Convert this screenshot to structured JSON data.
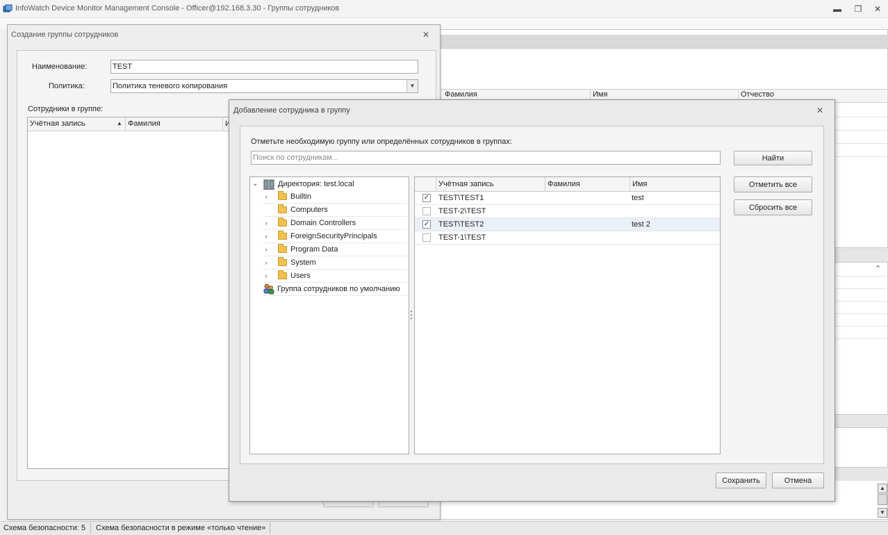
{
  "app": {
    "title": "InfoWatch Device Monitor Management Console - Officer@192.168.3.30 - Группы сотрудников",
    "minimize": "▬",
    "restore": "❐",
    "close": "✕"
  },
  "background": {
    "columns": [
      "Фамилия",
      "Имя",
      "Отчество"
    ],
    "scroll_up": "▲",
    "scroll_down": "▼",
    "collapse": "⌃"
  },
  "status_bar": {
    "schema": "Схема безопасности: 5",
    "mode": "Схема безопасности в режиме «только чтение»"
  },
  "create_dialog": {
    "title": "Создание группы сотрудников",
    "close": "✕",
    "name_label": "Наименование:",
    "name_value": "TEST",
    "policy_label": "Политика:",
    "policy_value": "Политика теневого копирования",
    "members_label": "Сотрудники в группе:",
    "columns": [
      "Учётная запись",
      "Фамилия",
      "И"
    ],
    "sort_indicator": "▲"
  },
  "add_dialog": {
    "title": "Добавление сотрудника в группу",
    "close": "✕",
    "instruction": "Отметьте необходимую группу или определённых сотрудников в группах:",
    "search_placeholder": "Поиск по сотрудникам...",
    "find_button": "Найти",
    "check_all_button": "Отметить все",
    "reset_all_button": "Сбросить все",
    "save_button": "Сохранить",
    "cancel_button": "Отмена",
    "tree": {
      "root": "Директория: test.local",
      "items": [
        {
          "label": "Builtin",
          "expandable": true
        },
        {
          "label": "Computers",
          "expandable": false
        },
        {
          "label": "Domain Controllers",
          "expandable": true
        },
        {
          "label": "ForeignSecurityPrincipals",
          "expandable": true
        },
        {
          "label": "Program Data",
          "expandable": true
        },
        {
          "label": "System",
          "expandable": true
        },
        {
          "label": "Users",
          "expandable": true
        }
      ],
      "default_group": "Группа сотрудников по умолчанию",
      "expanded_arrow": "⌄",
      "collapsed_arrow": "›"
    },
    "grid": {
      "columns": [
        "Учётная запись",
        "Фамилия",
        "Имя"
      ],
      "rows": [
        {
          "account": "TEST\\TEST1",
          "last_name": "",
          "first_name": "test",
          "checked": true
        },
        {
          "account": "TEST-2\\TEST",
          "last_name": "",
          "first_name": "",
          "checked": false
        },
        {
          "account": "TEST\\TEST2",
          "last_name": "",
          "first_name": "test 2",
          "checked": true
        },
        {
          "account": "TEST-1\\TEST",
          "last_name": "",
          "first_name": "",
          "checked": false
        }
      ],
      "check_mark": "✓"
    }
  }
}
